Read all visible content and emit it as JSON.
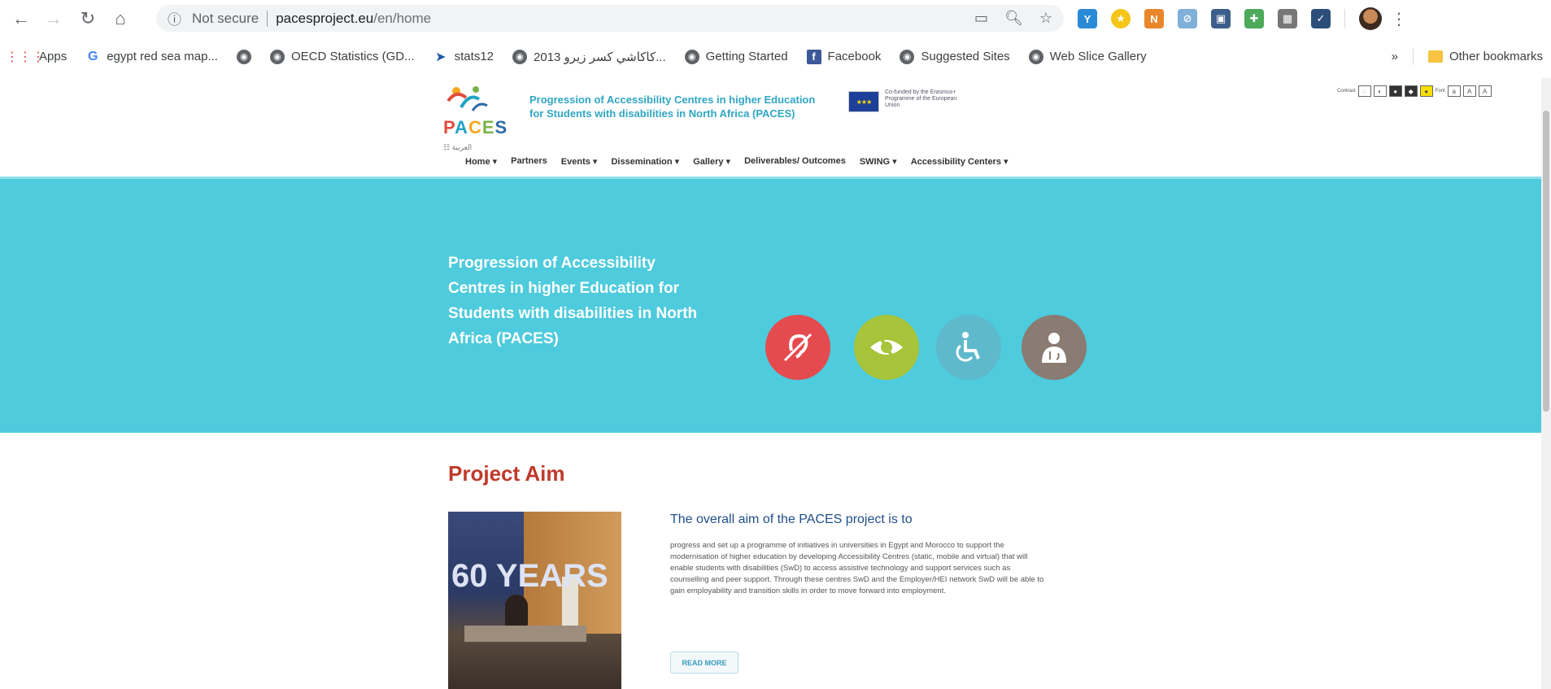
{
  "browser": {
    "security_label": "Not secure",
    "url_host": "pacesproject.eu",
    "url_path": "/en/home",
    "bookmarks": [
      {
        "label": "Apps",
        "icon": "apps-grid-icon"
      },
      {
        "label": "egypt red sea map...",
        "icon": "google-icon"
      },
      {
        "label": "",
        "icon": "globe-icon"
      },
      {
        "label": "OECD Statistics (GD...",
        "icon": "globe-icon"
      },
      {
        "label": "stats12",
        "icon": "stats-icon"
      },
      {
        "label": "كاكاشي كسر زيرو 2013...",
        "icon": "globe-icon"
      },
      {
        "label": "Getting Started",
        "icon": "globe-icon"
      },
      {
        "label": "Facebook",
        "icon": "facebook-icon"
      },
      {
        "label": "Suggested Sites",
        "icon": "globe-icon"
      },
      {
        "label": "Web Slice Gallery",
        "icon": "globe-icon"
      }
    ],
    "overflow_label": "»",
    "other_bookmarks": "Other bookmarks"
  },
  "header": {
    "logo_text": "PACES",
    "lang_link": "☷ العربية",
    "title_line1": "Progression of Accessibility Centres in higher Education",
    "title_line2": "for Students with disabilities in North Africa (PACES)",
    "eu_text": "Co-funded by the Erasmus+ Programme of the European Union",
    "contrast_label": "Contrast",
    "font_label": "Font",
    "nav": [
      "Home ▾",
      "Partners",
      "Events ▾",
      "Dissemination ▾",
      "Gallery ▾",
      "Deliverables/ Outcomes",
      "SWING ▾",
      "Accessibility Centers ▾"
    ]
  },
  "hero": {
    "title": "Progression of Accessibility Centres in higher Education for Students with disabilities in North Africa (PACES)",
    "icons": [
      {
        "name": "hearing-impaired-icon",
        "color": "#e54a4f"
      },
      {
        "name": "visually-impaired-icon",
        "color": "#a7c43a"
      },
      {
        "name": "wheelchair-icon",
        "color": "#5fb9cc"
      },
      {
        "name": "person-disability-icon",
        "color": "#8a7b73"
      }
    ]
  },
  "content": {
    "section_title": "Project Aim",
    "aim_title": "The overall aim of the PACES project is to",
    "aim_text": "progress and set up a programme of initiatives in universities in Egypt and Morocco to support the modernisation of higher education by developing Accessibility Centres (static, mobile and virtual) that will enable students with disabilities (SwD) to access assistive technology and support services such as counselling and peer support. Through these centres SwD and the Employer/HEI network SwD will be able to gain employability and transition skills in order to move forward into employment.",
    "read_more": "READ MORE",
    "photo_text": "60 YEARS"
  }
}
